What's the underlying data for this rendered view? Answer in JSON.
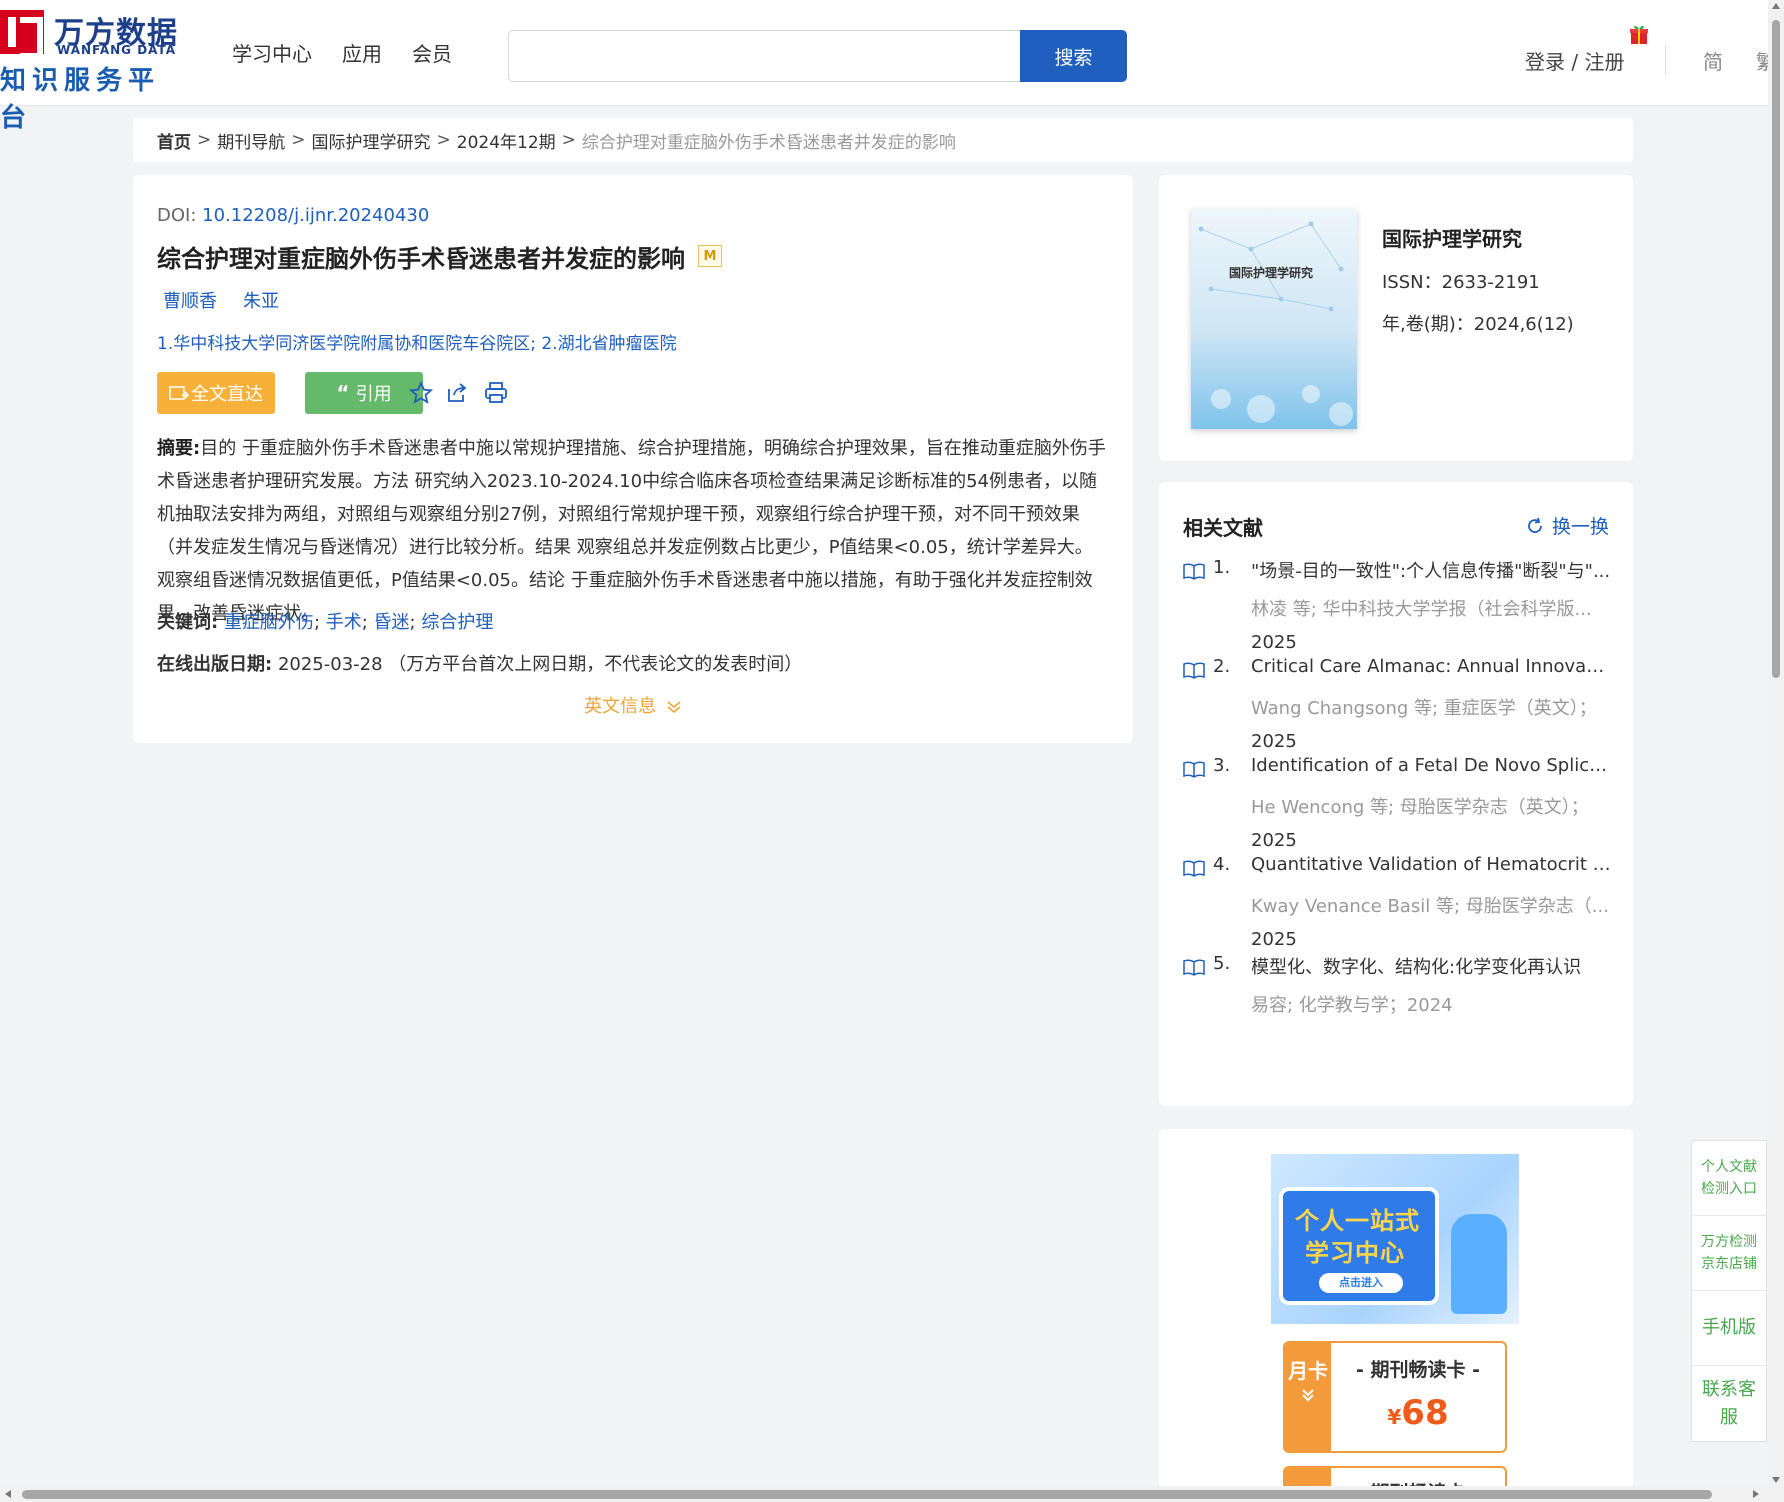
{
  "header": {
    "logo": {
      "cn": "万方数据",
      "en": "WANFANG DATA",
      "sub": "知识服务平台"
    },
    "nav": [
      "学习中心",
      "应用",
      "会员"
    ],
    "search": {
      "placeholder": "",
      "button": "搜索"
    },
    "login": "登录 / 注册",
    "lang": {
      "simplified": "简",
      "traditional": "繁"
    }
  },
  "breadcrumb": {
    "home": "首页",
    "items": [
      "期刊导航",
      "国际护理学研究",
      "2024年12期"
    ],
    "current": "综合护理对重症脑外伤手术昏迷患者并发症的影响"
  },
  "article": {
    "doi_label": "DOI:",
    "doi": "10.12208/j.ijnr.20240430",
    "title": "综合护理对重症脑外伤手术昏迷患者并发症的影响",
    "badge": "M",
    "authors": [
      "曹顺香",
      "朱亚"
    ],
    "affiliations": "1.华中科技大学同济医学院附属协和医院车谷院区; 2.湖北省肿瘤医院",
    "buttons": {
      "fulltext": "全文直达",
      "cite": "引用"
    },
    "abstract_label": "摘要:",
    "abstract": "目的 于重症脑外伤手术昏迷患者中施以常规护理措施、综合护理措施，明确综合护理效果，旨在推动重症脑外伤手术昏迷患者护理研究发展。方法 研究纳入2023.10-2024.10中综合临床各项检查结果满足诊断标准的54例患者，以随机抽取法安排为两组，对照组与观察组分别27例，对照组行常规护理干预，观察组行综合护理干预，对不同干预效果（并发症发生情况与昏迷情况）进行比较分析。结果 观察组总并发症例数占比更少，P值结果<0.05，统计学差异大。观察组昏迷情况数据值更低，P值结果<0.05。结论 于重症脑外伤手术昏迷患者中施以措施，有助于强化并发症控制效果，改善昏迷症状。",
    "keywords_label": "关键词:",
    "keywords": [
      "重症脑外伤",
      "手术",
      "昏迷",
      "综合护理"
    ],
    "pubdate_label": "在线出版日期:",
    "pubdate": "2025-03-28",
    "pubdate_note": "（万方平台首次上网日期，不代表论文的发表时间）",
    "english_info": "英文信息"
  },
  "journal": {
    "cover_title": "国际护理学研究",
    "name": "国际护理学研究",
    "issn": "ISSN：2633-2191",
    "year_vol": "年,卷(期)：2024,6(12)"
  },
  "related": {
    "title": "相关文献",
    "refresh": "换一换",
    "items": [
      {
        "num": "1.",
        "title": "\"场景-目的一致性\":个人信息传播\"断裂\"与\"...",
        "meta": "林凌  等;  华中科技大学学报（社会科学版...",
        "year": "2025"
      },
      {
        "num": "2.",
        "title": "Critical Care Almanac: Annual Innovation...",
        "meta": "Wang Changsong  等;  重症医学（英文）；",
        "year": "2025"
      },
      {
        "num": "3.",
        "title": "Identification of a Fetal De Novo Splice ...",
        "meta": "He Wencong  等;  母胎医学杂志（英文）；",
        "year": "2025"
      },
      {
        "num": "4.",
        "title": "Quantitative Validation of Hematocrit Pe...",
        "meta": "Kway Venance Basil  等;  母胎医学杂志（...",
        "year": "2025"
      },
      {
        "num": "5.",
        "title": "模型化、数字化、结构化:化学变化再认识",
        "meta": "易容; 化学教与学；2024",
        "year": ""
      }
    ]
  },
  "promo": {
    "banner_line1": "个人一站式",
    "banner_line2": "学习中心",
    "banner_enter": "点击进入",
    "card_side": "月卡",
    "card_title": "- 期刊畅读卡 -",
    "card_price_symbol": "¥",
    "card_price": "68",
    "card2_title": "- 期刊畅读卡 -"
  },
  "float_panel": [
    "个人文献检测入口",
    "万方检测京东店铺",
    "手机版",
    "联系客服"
  ],
  "colors": {
    "brand_blue": "#1f5fbd",
    "orange": "#f7b13a",
    "green": "#64b96a"
  }
}
